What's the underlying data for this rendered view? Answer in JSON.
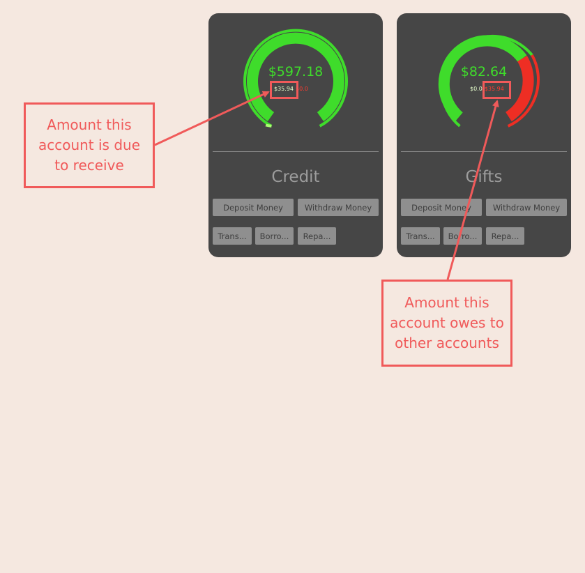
{
  "accounts": [
    {
      "name": "Credit",
      "balance": "$597.18",
      "due_to_receive": "$35.94",
      "owes": "$0.0",
      "gauge_green_fraction": 1.0,
      "buttons": {
        "deposit": "Deposit Money",
        "withdraw": "Withdraw Money",
        "transfer": "Trans...",
        "borrow": "Borro...",
        "repay": "Repa..."
      }
    },
    {
      "name": "Gifts",
      "balance": "$82.64",
      "due_to_receive": "$0.0",
      "owes": "$35.94",
      "gauge_green_fraction": 0.7,
      "buttons": {
        "deposit": "Deposit Money",
        "withdraw": "Withdraw Money",
        "transfer": "Trans...",
        "borrow": "Borro...",
        "repay": "Repa..."
      }
    }
  ],
  "annotations": {
    "receive": "Amount this account is due to receive",
    "owes": "Amount this account owes to other accounts"
  },
  "colors": {
    "page_bg": "#f5e8e0",
    "card_bg": "#464646",
    "gauge_green": "#3fdc2b",
    "gauge_red": "#ee2e24",
    "annotation": "#f05a5a"
  }
}
